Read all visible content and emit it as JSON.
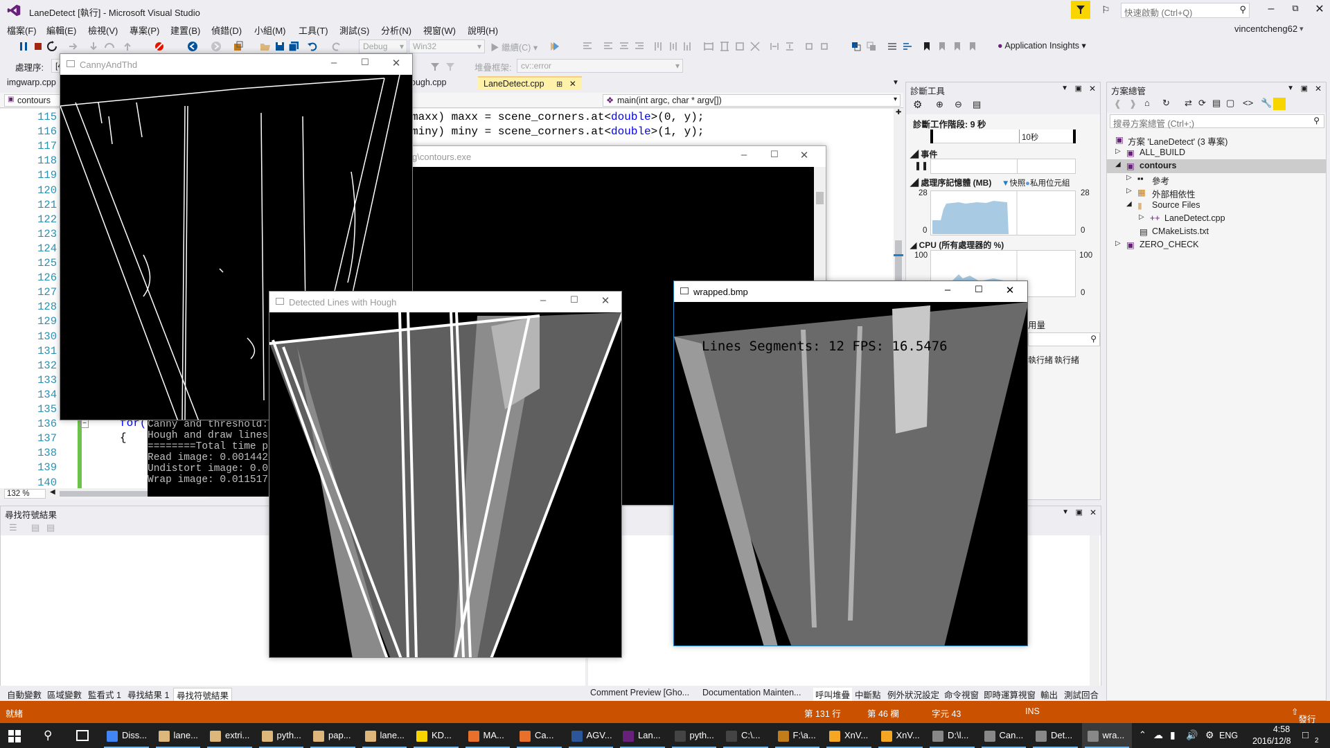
{
  "window": {
    "title": "LaneDetect [執行] - Microsoft Visual Studio",
    "quick_launch_placeholder": "快速啟動 (Ctrl+Q)",
    "user": "vincentcheng62"
  },
  "menu": [
    "檔案(F)",
    "編輯(E)",
    "檢視(V)",
    "專案(P)",
    "建置(B)",
    "偵錯(D)",
    "小組(M)",
    "工具(T)",
    "測試(S)",
    "分析(N)",
    "視窗(W)",
    "說明(H)"
  ],
  "toolbar": {
    "config": "Debug",
    "platform": "Win32",
    "continue_label": "繼續(C)",
    "app_insights": "Application Insights",
    "process_label": "處理序:",
    "process_value": "[4",
    "stack_frame_label": "堆疊框架:",
    "stack_frame_value": "cv::error"
  },
  "editor": {
    "tabs": [
      "imgwarp.cpp",
      "ough.cpp",
      "LaneDetect.cpp"
    ],
    "active_tab": "LaneDetect.cpp",
    "scope": "contours",
    "function_nav": "main(int argc, char * argv[])",
    "zoom": "132 %",
    "line_numbers": [
      "115",
      "116",
      "117",
      "118",
      "119",
      "120",
      "121",
      "122",
      "123",
      "124",
      "125",
      "126",
      "127",
      "128",
      "129",
      "130",
      "131",
      "132",
      "133",
      "134",
      "135",
      "136",
      "137",
      "138",
      "139",
      "140"
    ],
    "code_visible": [
      {
        "pre": "maxx) maxx = scene_corners.at<",
        "kw": "double",
        "post": ">(0, y);"
      },
      {
        "pre": "miny) miny = scene_corners.at<",
        "kw": "double",
        "post": ">(1, y);"
      }
    ],
    "code_for": "for(",
    "code_brace": "{"
  },
  "console_window": {
    "title": "g\\contours.exe",
    "lines": [
      "Canny and threshold: 0",
      "Hough and draw lines: ",
      "========Total time per",
      "Read image: 0.001442 s",
      "Undistort image: 0.019",
      "Wrap image: 0.011517 s"
    ]
  },
  "cv_windows": {
    "canny": {
      "title": "CannyAndThd"
    },
    "hough": {
      "title": "Detected Lines with Hough"
    },
    "wrapped": {
      "title": "wrapped.bmp",
      "overlay": "Lines Segments: 12 FPS: 16.5476"
    }
  },
  "diag": {
    "title": "診斷工具",
    "session": "診斷工作階段: 9 秒",
    "timeline_label": "10秒",
    "events": "事件",
    "memory": "處理序記憶體 (MB)",
    "snapshot": "快照",
    "private_bytes": "私用位元組",
    "mem_max": "28",
    "mem_min": "0",
    "cpu": "CPU (所有處理器的 %)",
    "cpu_max": "100",
    "cpu_min": "0",
    "usage_tab": "用量",
    "col_a": "執行緒",
    "col_b": "執行緒"
  },
  "solution_explorer": {
    "title": "方案總管",
    "search_placeholder": "搜尋方案總管 (Ctrl+;)",
    "items": [
      {
        "label": "方案 'LaneDetect' (3 專案)"
      },
      {
        "label": "ALL_BUILD"
      },
      {
        "label": "contours"
      },
      {
        "label": "參考"
      },
      {
        "label": "外部相依性"
      },
      {
        "label": "Source Files"
      },
      {
        "label": "LaneDetect.cpp"
      },
      {
        "label": "CMakeLists.txt"
      },
      {
        "label": "ZERO_CHECK"
      }
    ]
  },
  "find_panel": {
    "title": "尋找符號結果"
  },
  "bottom_tabs_left": [
    "自動變數",
    "區域變數",
    "監看式 1",
    "尋找結果 1",
    "尋找符號結果"
  ],
  "bottom_tabs_right": [
    "Comment Preview [Gho...",
    "Documentation Mainten...",
    "呼叫堆疊",
    "中斷點",
    "例外狀況設定",
    "命令視窗",
    "即時運算視窗",
    "輸出",
    "測試回合"
  ],
  "status": {
    "ready": "就緒",
    "line": "第 131 行",
    "col": "第 46 欄",
    "char": "字元 43",
    "ins": "INS",
    "publish": "發行"
  },
  "taskbar": {
    "items": [
      "Diss...",
      "lane...",
      "extri...",
      "pyth...",
      "pap...",
      "lane...",
      "KD...",
      "MA...",
      "Ca...",
      "AGV...",
      "Lan...",
      "pyth...",
      "C:\\...",
      "F:\\a...",
      "XnV...",
      "XnV...",
      "D:\\l...",
      "Can...",
      "Det...",
      "wra..."
    ],
    "lang": "ENG",
    "time": "4:58",
    "date": "2016/12/8",
    "notif": "2"
  },
  "colors": {
    "accent": "#007acc",
    "status": "#ca5100",
    "keyword": "#0000ff",
    "linenum": "#2b91af",
    "chart_fill": "#a8cbe3"
  }
}
